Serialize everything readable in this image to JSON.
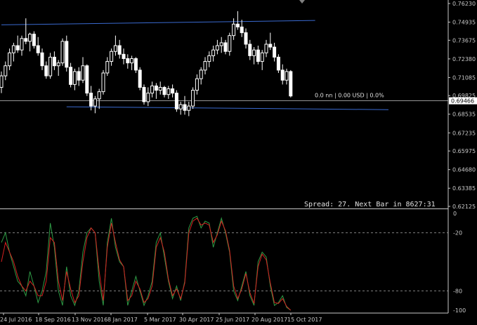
{
  "colors": {
    "background": "#000000",
    "axis": "#c8c8c8",
    "candle_up": "#ffffff",
    "candle_down": "#ffffff",
    "channel": "#3a6ad0",
    "price_line": "#c8c8c8",
    "grid_dash": "#808080",
    "stoch_main": "#2e9b45",
    "stoch_signal": "#d62020",
    "price_tag_bg": "#ffffff",
    "price_tag_fg": "#000000"
  },
  "chart_data": {
    "type": "candlestick",
    "price_axis_labels": [
      "0.76230",
      "0.74935",
      "0.73675",
      "0.72380",
      "0.71085",
      "0.69825",
      "0.68535",
      "0.67235",
      "0.65975",
      "0.64680",
      "0.63385",
      "0.62125"
    ],
    "price_ylim": [
      0.62125,
      0.7623
    ],
    "current_price": "0.69466",
    "info_label": "0.0 nn | 0.00 USD | 0.0%",
    "spread_label": "Spread: 27. Next Bar in 8627:31",
    "date_labels": [
      "24 Jul 2016",
      "18 Sep 2016",
      "13 Nov 2016",
      "8 Jan 2017",
      "5 Mar 2017",
      "30 Apr 2017",
      "25 Jun 2017",
      "20 Aug 2017",
      "15 Oct 2017"
    ],
    "candles": [
      [
        0.704,
        0.715,
        0.7,
        0.712
      ],
      [
        0.712,
        0.722,
        0.709,
        0.719
      ],
      [
        0.719,
        0.731,
        0.716,
        0.728
      ],
      [
        0.728,
        0.735,
        0.722,
        0.733
      ],
      [
        0.733,
        0.74,
        0.728,
        0.73
      ],
      [
        0.73,
        0.74,
        0.726,
        0.738
      ],
      [
        0.738,
        0.752,
        0.734,
        0.736
      ],
      [
        0.736,
        0.742,
        0.729,
        0.741
      ],
      [
        0.741,
        0.743,
        0.731,
        0.733
      ],
      [
        0.733,
        0.739,
        0.726,
        0.728
      ],
      [
        0.728,
        0.731,
        0.716,
        0.719
      ],
      [
        0.719,
        0.722,
        0.71,
        0.712
      ],
      [
        0.712,
        0.728,
        0.71,
        0.725
      ],
      [
        0.725,
        0.729,
        0.716,
        0.719
      ],
      [
        0.719,
        0.723,
        0.712,
        0.721
      ],
      [
        0.721,
        0.738,
        0.719,
        0.736
      ],
      [
        0.736,
        0.74,
        0.715,
        0.718
      ],
      [
        0.718,
        0.721,
        0.704,
        0.706
      ],
      [
        0.706,
        0.717,
        0.702,
        0.715
      ],
      [
        0.715,
        0.718,
        0.705,
        0.709
      ],
      [
        0.709,
        0.725,
        0.707,
        0.719
      ],
      [
        0.719,
        0.72,
        0.698,
        0.7
      ],
      [
        0.7,
        0.705,
        0.688,
        0.691
      ],
      [
        0.691,
        0.698,
        0.686,
        0.696
      ],
      [
        0.696,
        0.703,
        0.689,
        0.701
      ],
      [
        0.701,
        0.716,
        0.699,
        0.714
      ],
      [
        0.714,
        0.725,
        0.712,
        0.722
      ],
      [
        0.722,
        0.731,
        0.719,
        0.729
      ],
      [
        0.729,
        0.74,
        0.726,
        0.733
      ],
      [
        0.733,
        0.737,
        0.724,
        0.727
      ],
      [
        0.727,
        0.731,
        0.72,
        0.724
      ],
      [
        0.724,
        0.727,
        0.717,
        0.721
      ],
      [
        0.721,
        0.726,
        0.716,
        0.724
      ],
      [
        0.724,
        0.725,
        0.714,
        0.716
      ],
      [
        0.716,
        0.718,
        0.702,
        0.704
      ],
      [
        0.704,
        0.706,
        0.692,
        0.694
      ],
      [
        0.694,
        0.704,
        0.691,
        0.7
      ],
      [
        0.7,
        0.708,
        0.697,
        0.705
      ],
      [
        0.705,
        0.707,
        0.696,
        0.702
      ],
      [
        0.702,
        0.708,
        0.699,
        0.704
      ],
      [
        0.704,
        0.705,
        0.697,
        0.699
      ],
      [
        0.699,
        0.705,
        0.696,
        0.703
      ],
      [
        0.703,
        0.706,
        0.697,
        0.7
      ],
      [
        0.7,
        0.702,
        0.687,
        0.689
      ],
      [
        0.689,
        0.694,
        0.685,
        0.692
      ],
      [
        0.692,
        0.698,
        0.685,
        0.688
      ],
      [
        0.688,
        0.694,
        0.684,
        0.691
      ],
      [
        0.691,
        0.704,
        0.689,
        0.702
      ],
      [
        0.702,
        0.713,
        0.699,
        0.71
      ],
      [
        0.71,
        0.718,
        0.706,
        0.716
      ],
      [
        0.716,
        0.725,
        0.713,
        0.722
      ],
      [
        0.722,
        0.729,
        0.718,
        0.726
      ],
      [
        0.726,
        0.733,
        0.722,
        0.73
      ],
      [
        0.73,
        0.737,
        0.727,
        0.733
      ],
      [
        0.733,
        0.739,
        0.728,
        0.735
      ],
      [
        0.735,
        0.737,
        0.727,
        0.729
      ],
      [
        0.729,
        0.742,
        0.726,
        0.74
      ],
      [
        0.74,
        0.752,
        0.737,
        0.748
      ],
      [
        0.748,
        0.757,
        0.744,
        0.746
      ],
      [
        0.746,
        0.751,
        0.739,
        0.742
      ],
      [
        0.742,
        0.745,
        0.731,
        0.734
      ],
      [
        0.734,
        0.737,
        0.723,
        0.726
      ],
      [
        0.726,
        0.732,
        0.72,
        0.73
      ],
      [
        0.73,
        0.733,
        0.72,
        0.722
      ],
      [
        0.722,
        0.73,
        0.716,
        0.728
      ],
      [
        0.728,
        0.737,
        0.725,
        0.734
      ],
      [
        0.734,
        0.742,
        0.73,
        0.732
      ],
      [
        0.732,
        0.735,
        0.722,
        0.725
      ],
      [
        0.725,
        0.727,
        0.714,
        0.716
      ],
      [
        0.716,
        0.72,
        0.706,
        0.709
      ],
      [
        0.709,
        0.717,
        0.706,
        0.715
      ],
      [
        0.715,
        0.716,
        0.697,
        0.698
      ]
    ],
    "channel_upper": {
      "x": [
        0,
        77
      ],
      "y": [
        0.7475,
        0.7505
      ]
    },
    "channel_lower": {
      "x": [
        16,
        95
      ],
      "y": [
        0.6905,
        0.6885
      ]
    },
    "oscillator": {
      "labels": [
        "0",
        "-20",
        "-80",
        "-100"
      ],
      "levels": [
        -20,
        -80
      ],
      "ylim": [
        -100,
        0
      ],
      "main": [
        -30,
        -20,
        -40,
        -55,
        -70,
        -75,
        -85,
        -60,
        -75,
        -92,
        -80,
        -60,
        -10,
        -35,
        -80,
        -95,
        -55,
        -85,
        -95,
        -80,
        -40,
        -20,
        -15,
        -20,
        -70,
        -95,
        -30,
        -5,
        -35,
        -50,
        -55,
        -95,
        -80,
        -65,
        -80,
        -95,
        -85,
        -70,
        -30,
        -20,
        -45,
        -70,
        -88,
        -75,
        -90,
        -70,
        -15,
        -5,
        -3,
        -15,
        -8,
        -10,
        -35,
        -20,
        -5,
        -20,
        -40,
        -80,
        -90,
        -75,
        -60,
        -85,
        -95,
        -50,
        -40,
        -45,
        -75,
        -95,
        -92,
        -85,
        -97,
        -100
      ],
      "signal": [
        -50,
        -30,
        -40,
        -50,
        -65,
        -75,
        -80,
        -70,
        -75,
        -85,
        -85,
        -70,
        -25,
        -30,
        -70,
        -90,
        -60,
        -78,
        -92,
        -85,
        -50,
        -25,
        -15,
        -20,
        -60,
        -90,
        -35,
        -10,
        -30,
        -48,
        -55,
        -90,
        -85,
        -70,
        -78,
        -92,
        -88,
        -75,
        -35,
        -25,
        -40,
        -68,
        -85,
        -78,
        -88,
        -72,
        -20,
        -8,
        -5,
        -12,
        -10,
        -12,
        -30,
        -22,
        -8,
        -18,
        -38,
        -75,
        -88,
        -78,
        -62,
        -82,
        -93,
        -55,
        -42,
        -48,
        -72,
        -92,
        -93,
        -88,
        -96,
        -100
      ]
    }
  }
}
